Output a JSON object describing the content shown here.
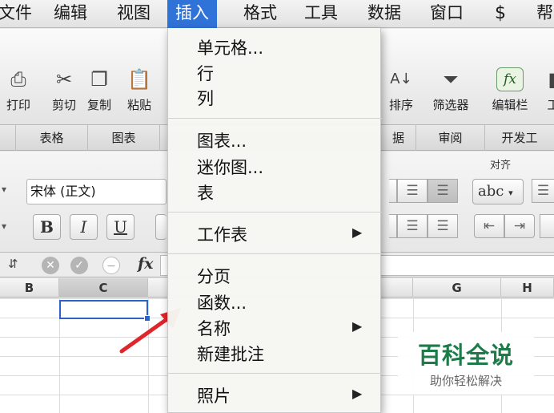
{
  "menubar": {
    "items": [
      "文件",
      "编辑",
      "视图",
      "插入",
      "格式",
      "工具",
      "数据",
      "窗口",
      "帮"
    ],
    "active": "插入"
  },
  "toolbar": {
    "buttons": [
      "打印",
      "剪切",
      "复制",
      "粘贴",
      "排序",
      "筛选器",
      "编辑栏",
      "工"
    ],
    "fx_label": "fx"
  },
  "ribbon_tabs": [
    "表格",
    "图表",
    "据",
    "审阅",
    "开发工"
  ],
  "ribbon": {
    "font_name": "宋体 (正文)",
    "bold": "B",
    "italic": "I",
    "underline": "U",
    "align_group": "对齐",
    "wrap_label": "abc"
  },
  "formula_bar": {
    "fx": "fx"
  },
  "columns": [
    "B",
    "C",
    "G",
    "H"
  ],
  "insert_menu": {
    "items": [
      "单元格...",
      "行",
      "列",
      "图表...",
      "迷你图...",
      "表",
      "工作表",
      "分页",
      "函数...",
      "名称",
      "新建批注",
      "照片"
    ]
  },
  "watermark": {
    "title": "百科全说",
    "subtitle": "助你轻松解决"
  },
  "colors": {
    "menu_highlight": "#2f73d9",
    "selection": "#2b63c9",
    "arrow": "#e0262b",
    "watermark": "#1d7b4a"
  }
}
